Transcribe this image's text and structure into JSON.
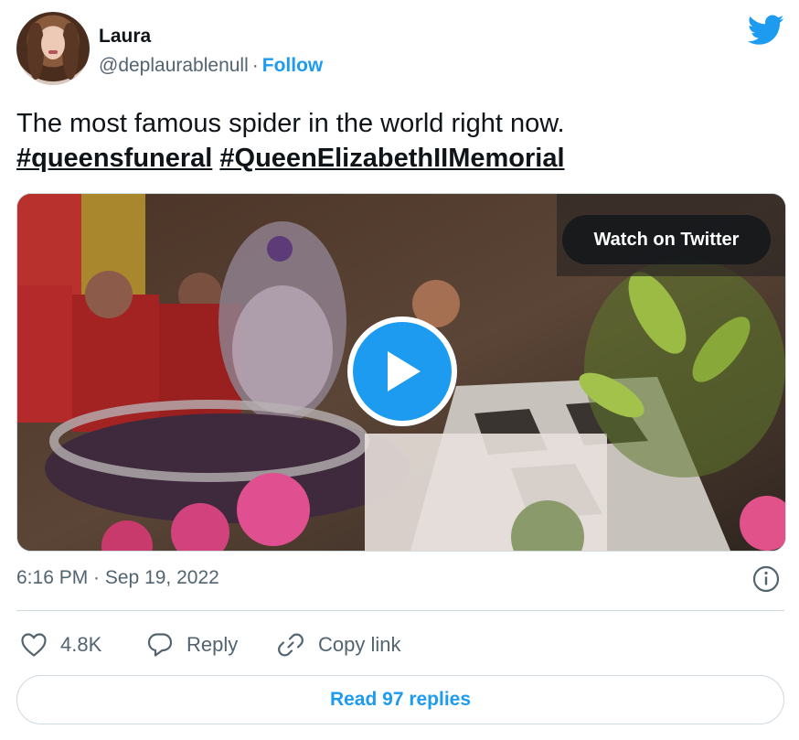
{
  "user": {
    "name": "Laura",
    "handle": "@deplaurablenull",
    "separator": "·",
    "follow_label": "Follow"
  },
  "tweet": {
    "text": "The most famous spider in the world right now.",
    "hashtags": [
      "#queensfuneral",
      "#QueenElizabethIIMemorial"
    ]
  },
  "media": {
    "watch_label": "Watch on Twitter"
  },
  "timestamp": "6:16 PM · Sep 19, 2022",
  "actions": {
    "likes": "4.8K",
    "reply_label": "Reply",
    "copy_link_label": "Copy link"
  },
  "read_replies_label": "Read 97 replies",
  "colors": {
    "accent": "#1d9bf0",
    "text": "#0f1419",
    "muted": "#536471",
    "border": "#cfd9de"
  },
  "icons": [
    "twitter-bird-icon",
    "play-icon",
    "info-icon",
    "heart-icon",
    "reply-bubble-icon",
    "link-icon"
  ]
}
